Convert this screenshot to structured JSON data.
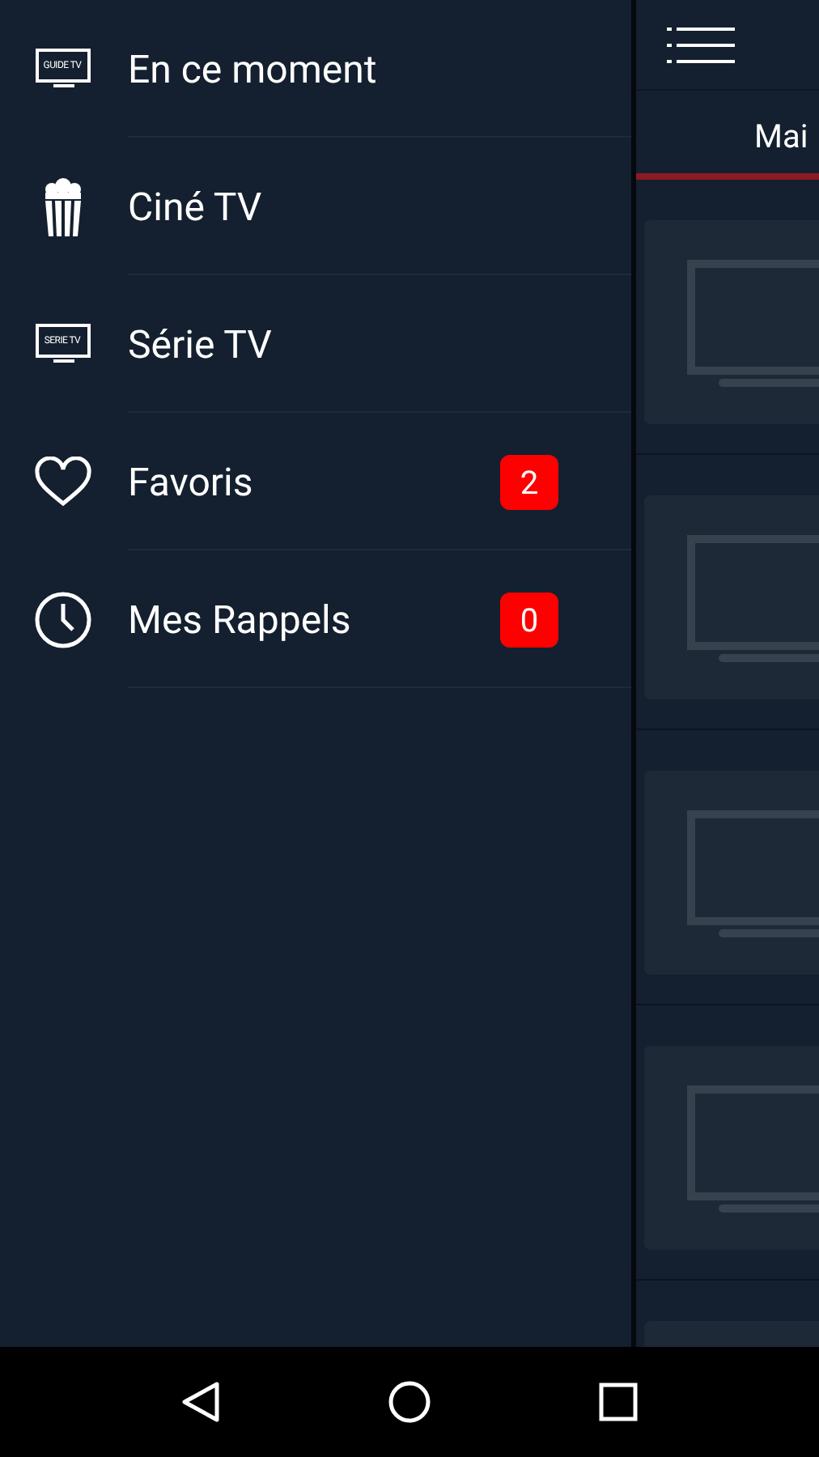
{
  "drawer": {
    "items": [
      {
        "kind": "guide",
        "label": "En ce moment",
        "icon_text": "GUIDE TV"
      },
      {
        "kind": "popcorn",
        "label": "Ciné TV"
      },
      {
        "kind": "serie",
        "label": "Série TV",
        "icon_text": "SERIE TV"
      },
      {
        "kind": "heart",
        "label": "Favoris",
        "badge": "2"
      },
      {
        "kind": "clock",
        "label": "Mes Rappels",
        "badge": "0"
      }
    ]
  },
  "main": {
    "tab": {
      "label": "Mai",
      "selected": true
    },
    "cards": [
      {
        "kind": "picture"
      },
      {
        "kind": "picture"
      },
      {
        "kind": "picture"
      },
      {
        "kind": "picture"
      },
      {
        "kind": "blank"
      }
    ]
  }
}
